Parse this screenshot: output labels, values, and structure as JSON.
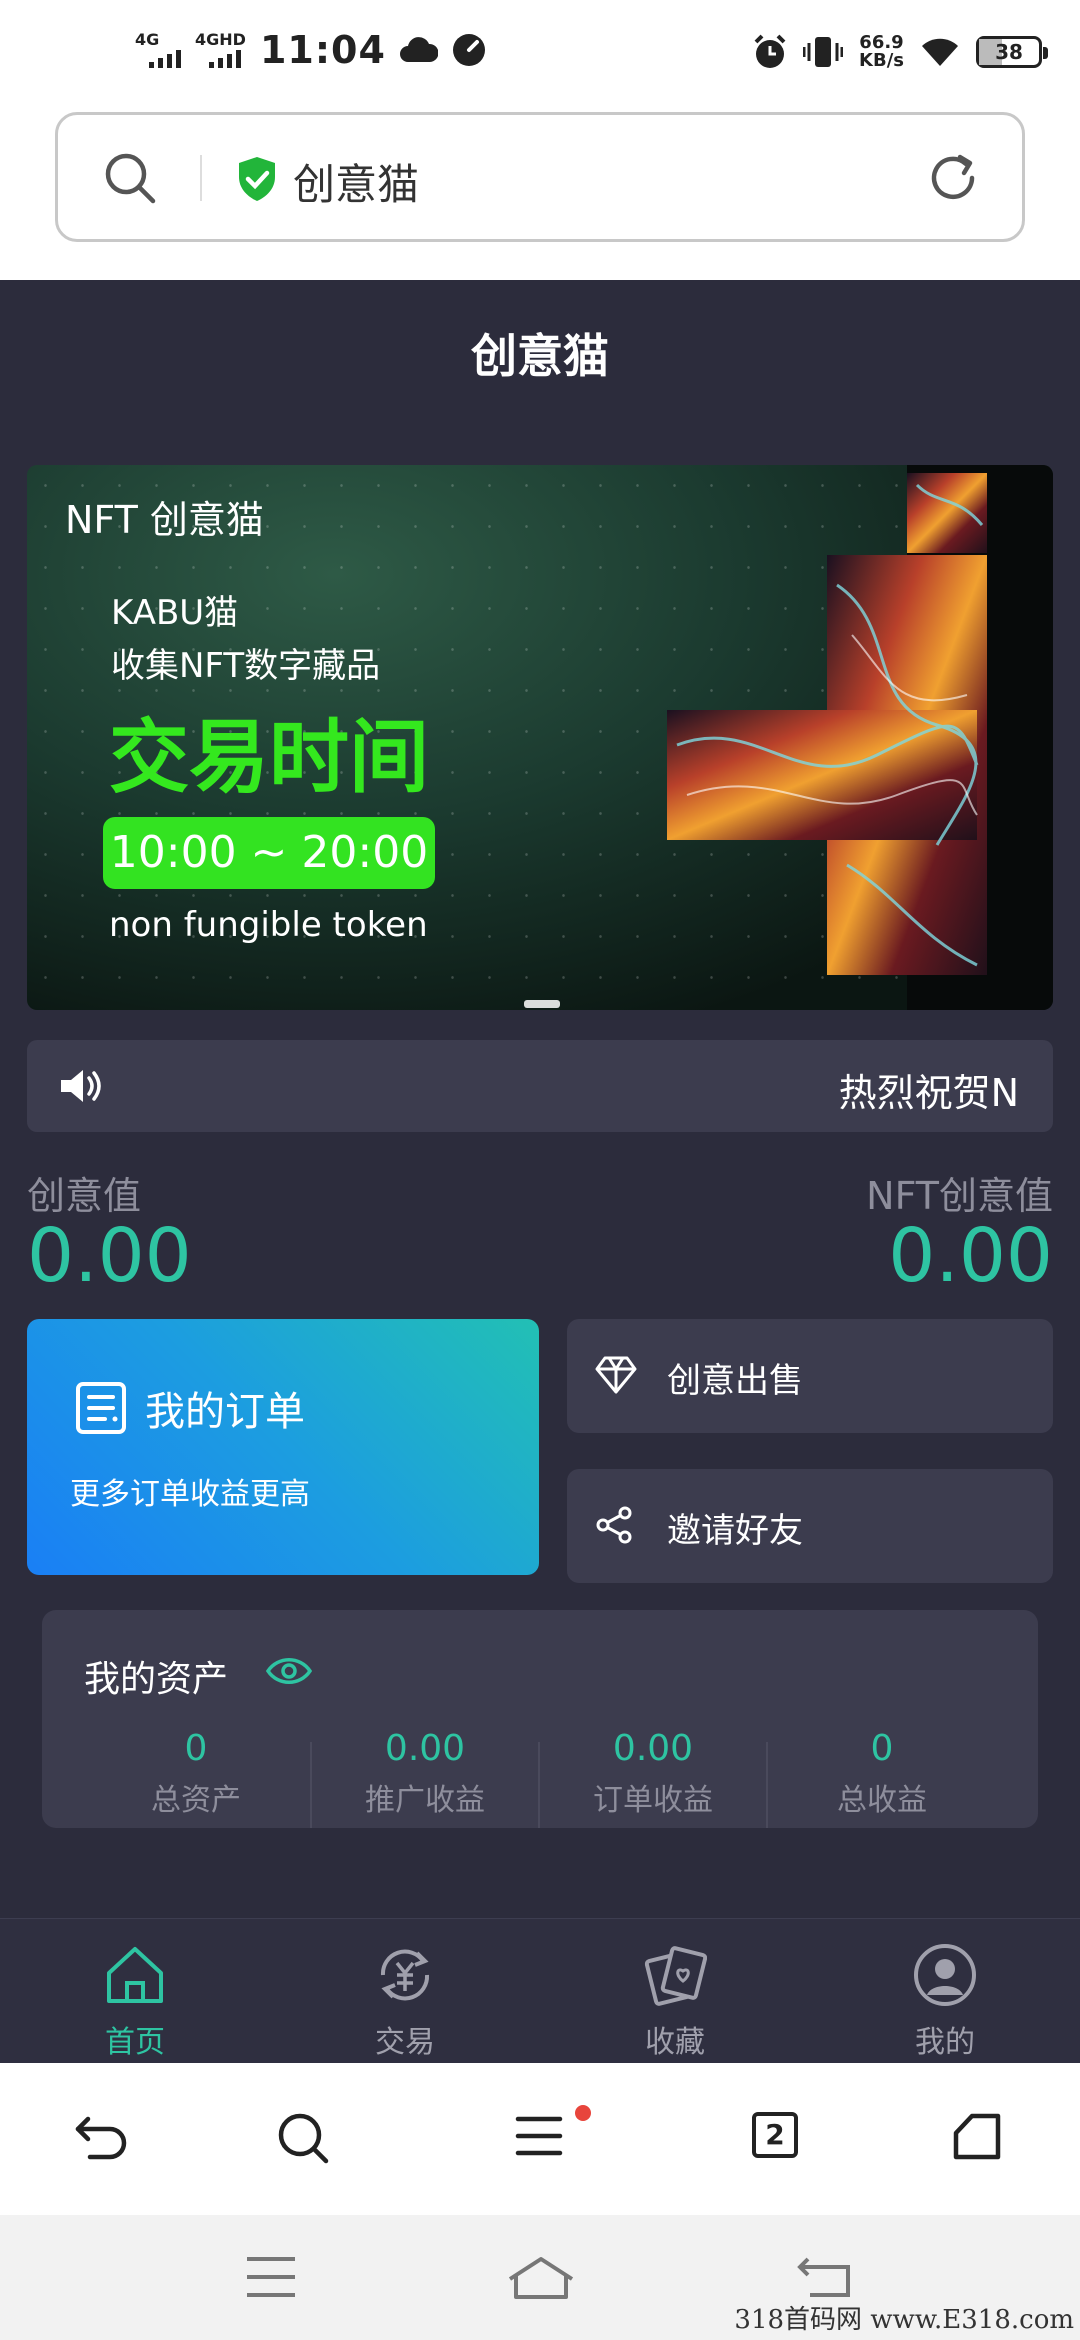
{
  "status_bar": {
    "network_1": "4G",
    "network_2": "4GHD",
    "time": "11:04",
    "speed_value": "66.9",
    "speed_unit": "KB/s",
    "battery": "38",
    "battery_level_percent": 38
  },
  "browser": {
    "address_title": "创意猫",
    "tab_count": "2",
    "menu_notification": true
  },
  "app": {
    "title": "创意猫",
    "banner": {
      "brand": "NFT 创意猫",
      "line1": "KABU猫",
      "line2": "收集NFT数字藏品",
      "headline": "交易时间",
      "time_range": "10:00 ~ 20:00",
      "footer": "non fungible token"
    },
    "notice_text": "热烈祝贺N",
    "values": {
      "left_label": "创意值",
      "left_value": "0.00",
      "right_label": "NFT创意值",
      "right_value": "0.00"
    },
    "order_card": {
      "title": "我的订单",
      "subtitle": "更多订单收益更高"
    },
    "actions": {
      "sell": "创意出售",
      "invite": "邀请好友"
    },
    "assets": {
      "title": "我的资产",
      "items": [
        {
          "value": "0",
          "label": "总资产"
        },
        {
          "value": "0.00",
          "label": "推广收益"
        },
        {
          "value": "0.00",
          "label": "订单收益"
        },
        {
          "value": "0",
          "label": "总收益"
        }
      ]
    },
    "tabs": [
      {
        "label": "首页",
        "icon": "home-icon",
        "active": true
      },
      {
        "label": "交易",
        "icon": "trade-icon",
        "active": false
      },
      {
        "label": "收藏",
        "icon": "collection-icon",
        "active": false
      },
      {
        "label": "我的",
        "icon": "profile-icon",
        "active": false
      }
    ]
  },
  "watermark": "318首码网 www.E318.com",
  "colors": {
    "app_bg": "#2c2c3c",
    "card_bg": "#3c3c4e",
    "accent": "#2ec4a2",
    "banner_green": "#33e321"
  }
}
